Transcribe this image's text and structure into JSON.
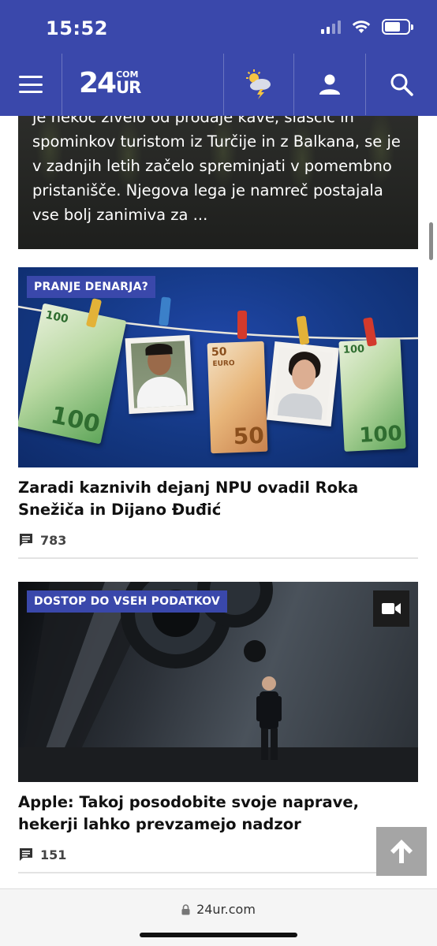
{
  "status": {
    "time": "15:52"
  },
  "header": {
    "logo_num": "24",
    "logo_com": "COM",
    "logo_ur": "UR"
  },
  "hero": {
    "text": "je nekoč živelo od prodaje kave, slaščic in spominkov turistom iz Turčije in z Balkana, se je v zadnjih letih začelo spreminjati v pomembno pristanišče. Njegova lega je namreč postajala vse bolj zanimiva za ..."
  },
  "articles": [
    {
      "tag": "PRANJE DENARJA?",
      "title": "Zaradi kaznivih dejanj NPU ovadil Roka Snežiča in Dijano Đuđić",
      "comments": "783"
    },
    {
      "tag": "DOSTOP DO VSEH PODATKOV",
      "title": "Apple: Takoj posodobite svoje naprave, hekerji lahko prevzamejo nadzor",
      "comments": "151"
    }
  ],
  "money_image": {
    "bill_100": "100",
    "bill_50": "50",
    "euro": "EURO"
  },
  "browser": {
    "url": "24ur.com"
  },
  "colors": {
    "brand": "#3a48ab",
    "tag": "#3a48ab"
  }
}
